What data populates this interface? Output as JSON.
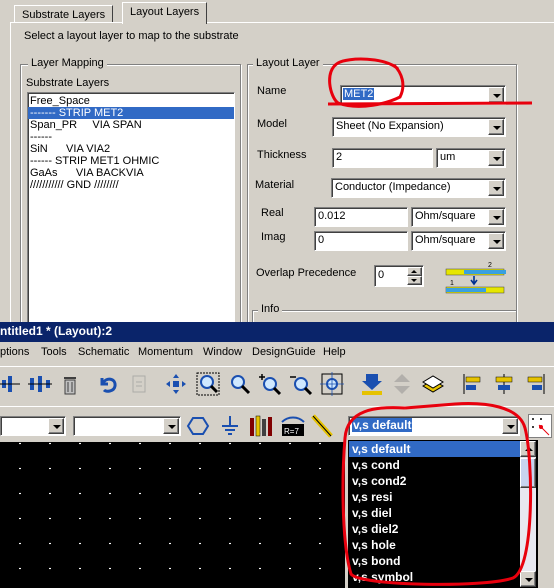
{
  "dialog": {
    "tabs": [
      "Substrate Layers",
      "Layout Layers"
    ],
    "instruction": "Select a layout layer to map to the substrate",
    "layer_mapping": {
      "title": "Layer Mapping",
      "list_label": "Substrate Layers",
      "items": [
        "Free_Space",
        "------- STRIP MET2",
        "Span_PR     VIA SPAN",
        "------",
        "SiN      VIA VIA2",
        "------ STRIP MET1 OHMIC",
        "GaAs      VIA BACKVIA",
        "/////////// GND ////////"
      ],
      "selected_index": 1
    },
    "layout_layer": {
      "title": "Layout Layer",
      "name_label": "Name",
      "name_value": "MET2",
      "model_label": "Model",
      "model_value": "Sheet (No Expansion)",
      "thickness_label": "Thickness",
      "thickness_value": "2",
      "thickness_unit": "um",
      "material_label": "Material",
      "material_value": "Conductor (Impedance)",
      "real_label": "Real",
      "real_value": "0.012",
      "real_unit": "Ohm/square",
      "imag_label": "Imag",
      "imag_value": "0",
      "imag_unit": "Ohm/square",
      "overlap_label": "Overlap Precedence",
      "overlap_value": "0",
      "info_label": "Info"
    }
  },
  "layout_window": {
    "title": "ntitled1 * (Layout):2",
    "menu": [
      "ptions",
      "Tools",
      "Schematic",
      "Momentum",
      "Window",
      "DesignGuide",
      "Help"
    ],
    "layer_combo_value": "v,s default",
    "dropdown_items": [
      "v,s default",
      "v,s cond",
      "v,s cond2",
      "v,s resi",
      "v,s diel",
      "v,s diel2",
      "v,s hole",
      "v,s bond",
      "v,s symbol"
    ],
    "dropdown_selected_index": 0
  },
  "colors": {
    "window_bg": "#d4d0c8",
    "title_bar": "#0a246a",
    "selection": "#316ac5",
    "annotation": "#e8000d",
    "canvas": "#000000"
  }
}
